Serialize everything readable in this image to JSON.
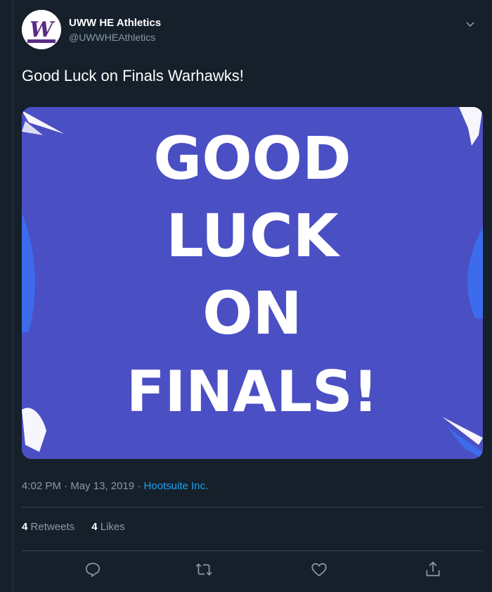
{
  "account": {
    "display_name": "UWW HE Athletics",
    "handle": "@UWWHEAthletics",
    "avatar_letter": "W"
  },
  "tweet": {
    "text": "Good Luck on Finals Warhawks!",
    "image_lines": [
      "GOOD",
      "LUCK",
      "ON",
      "FINALS!"
    ],
    "time": "4:02 PM",
    "date": "May 13, 2019",
    "source": "Hootsuite Inc."
  },
  "stats": {
    "retweets_count": "4",
    "retweets_label": "Retweets",
    "likes_count": "4",
    "likes_label": "Likes"
  },
  "icons": {
    "reply": "reply-icon",
    "retweet": "retweet-icon",
    "like": "heart-icon",
    "share": "share-icon",
    "menu": "chevron-down-icon"
  },
  "colors": {
    "background": "#15202b",
    "image_bg": "#4b4fc4",
    "link": "#1da1f2",
    "muted": "#8899a6",
    "avatar_purple": "#5b2a86"
  }
}
